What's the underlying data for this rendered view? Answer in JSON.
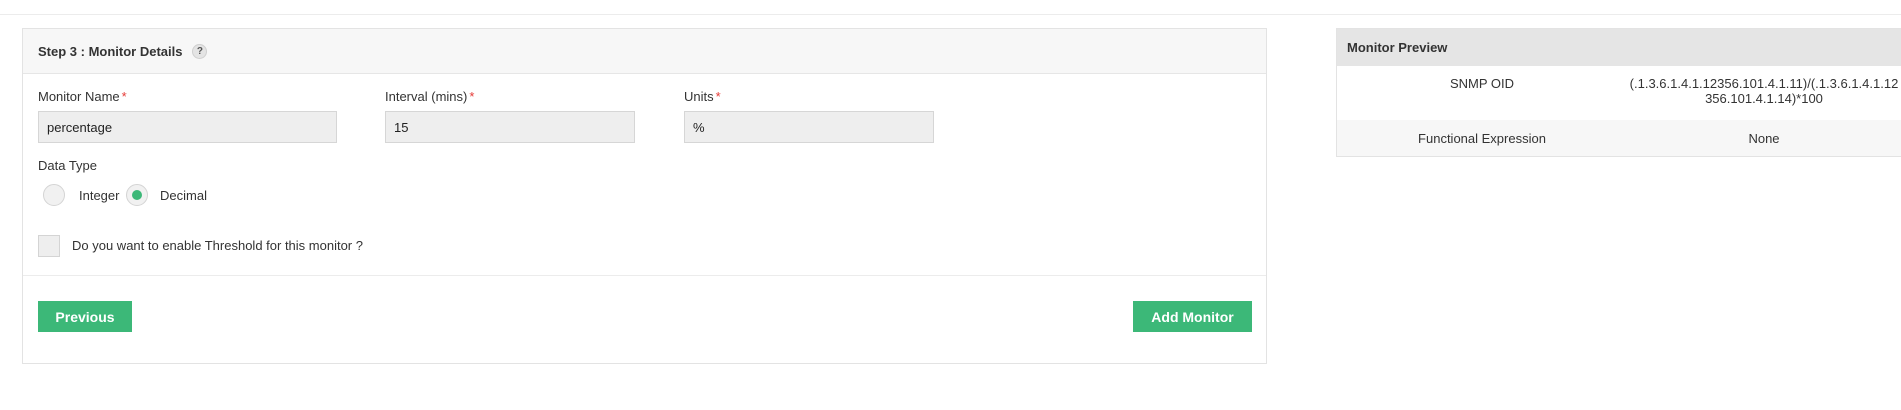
{
  "step": {
    "title": "Step 3 : Monitor Details",
    "help_icon": "?"
  },
  "form": {
    "monitor_name": {
      "label": "Monitor Name",
      "value": "percentage",
      "required_mark": "*"
    },
    "interval": {
      "label": "Interval (mins)",
      "value": "15",
      "required_mark": "*"
    },
    "units": {
      "label": "Units",
      "value": "%",
      "required_mark": "*"
    },
    "data_type": {
      "label": "Data Type",
      "options": [
        {
          "label": "Integer",
          "checked": false
        },
        {
          "label": "Decimal",
          "checked": true
        }
      ]
    },
    "threshold": {
      "label": "Do you want to enable Threshold for this monitor ?",
      "checked": false
    }
  },
  "buttons": {
    "previous": "Previous",
    "add_monitor": "Add Monitor"
  },
  "preview": {
    "title": "Monitor Preview",
    "rows": [
      {
        "key": "SNMP OID",
        "value_line1": "(.1.3.6.1.4.1.12356.101.4.1.11)/(.1.3.6.1.4.1.12",
        "value_line2": "356.101.4.1.14)*100"
      },
      {
        "key": "Functional Expression",
        "value": "None"
      }
    ]
  },
  "colors": {
    "accent": "#3cb878",
    "required": "#e53935"
  }
}
